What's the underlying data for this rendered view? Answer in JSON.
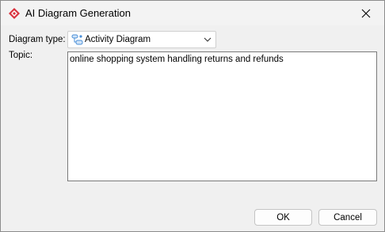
{
  "window": {
    "title": "AI Diagram Generation",
    "app_icon": "diamond-app-icon",
    "close_icon": "close-icon"
  },
  "form": {
    "diagram_type_label": "Diagram type:",
    "diagram_type_value": "Activity Diagram",
    "diagram_type_icon": "activity-diagram-icon",
    "topic_label": "Topic:",
    "topic_value": "online shopping system handling returns and refunds"
  },
  "buttons": {
    "ok_label": "OK",
    "cancel_label": "Cancel"
  },
  "colors": {
    "app_icon": "#d9333f",
    "diagram_icon": "#4a8fd8",
    "window_bg": "#f0f0f0"
  }
}
